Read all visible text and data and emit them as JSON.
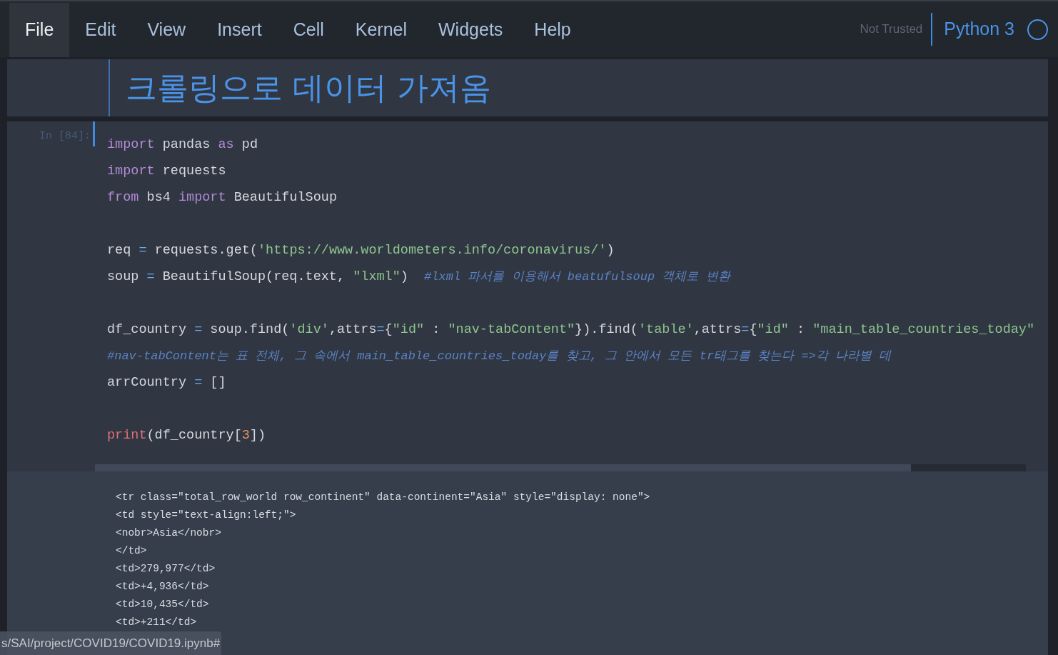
{
  "menu": [
    {
      "label": "File",
      "selected": true
    },
    {
      "label": "Edit",
      "selected": false
    },
    {
      "label": "View",
      "selected": false
    },
    {
      "label": "Insert",
      "selected": false
    },
    {
      "label": "Cell",
      "selected": false
    },
    {
      "label": "Kernel",
      "selected": false
    },
    {
      "label": "Widgets",
      "selected": false
    },
    {
      "label": "Help",
      "selected": false
    }
  ],
  "trust": "Not Trusted",
  "kernel": "Python 3",
  "markdown_cell": {
    "heading": "크롤링으로 데이터 가져옴"
  },
  "code_cell": {
    "prompt": "In [84]:",
    "blocks": [
      {
        "lines": [
          {
            "tokens": [
              {
                "text": "import",
                "kind": "keyword"
              },
              {
                "text": " pandas ",
                "kind": "plain"
              },
              {
                "text": "as",
                "kind": "keyword"
              },
              {
                "text": " pd",
                "kind": "plain"
              }
            ]
          },
          {
            "tokens": [
              {
                "text": "import",
                "kind": "keyword"
              },
              {
                "text": " requests",
                "kind": "plain"
              }
            ]
          },
          {
            "tokens": [
              {
                "text": "from",
                "kind": "keyword"
              },
              {
                "text": " bs4 ",
                "kind": "plain"
              },
              {
                "text": "import",
                "kind": "keyword"
              },
              {
                "text": " BeautifulSoup",
                "kind": "plain"
              }
            ]
          }
        ]
      },
      {
        "lines": [
          {
            "tokens": [
              {
                "text": "req ",
                "kind": "plain"
              },
              {
                "text": "=",
                "kind": "operator"
              },
              {
                "text": " requests.get(",
                "kind": "plain"
              },
              {
                "text": "'https://www.worldometers.info/coronavirus/'",
                "kind": "string"
              },
              {
                "text": ")",
                "kind": "plain"
              }
            ]
          },
          {
            "tokens": [
              {
                "text": "soup ",
                "kind": "plain"
              },
              {
                "text": "=",
                "kind": "operator"
              },
              {
                "text": " BeautifulSoup(req.text, ",
                "kind": "plain"
              },
              {
                "text": "\"lxml\"",
                "kind": "string"
              },
              {
                "text": ")  ",
                "kind": "plain"
              },
              {
                "text": "#lxml 파서를 이용해서 beatufulsoup 객체로 변환",
                "kind": "comment"
              }
            ]
          }
        ]
      },
      {
        "lines": [
          {
            "tokens": [
              {
                "text": "df_country ",
                "kind": "plain"
              },
              {
                "text": "=",
                "kind": "operator"
              },
              {
                "text": " soup.find(",
                "kind": "plain"
              },
              {
                "text": "'div'",
                "kind": "string"
              },
              {
                "text": ",attrs",
                "kind": "plain"
              },
              {
                "text": "=",
                "kind": "operator"
              },
              {
                "text": "{",
                "kind": "plain"
              },
              {
                "text": "\"id\"",
                "kind": "string"
              },
              {
                "text": " : ",
                "kind": "plain"
              },
              {
                "text": "\"nav-tabContent\"",
                "kind": "string"
              },
              {
                "text": "}).find(",
                "kind": "plain"
              },
              {
                "text": "'table'",
                "kind": "string"
              },
              {
                "text": ",attrs",
                "kind": "plain"
              },
              {
                "text": "=",
                "kind": "operator"
              },
              {
                "text": "{",
                "kind": "plain"
              },
              {
                "text": "\"id\"",
                "kind": "string"
              },
              {
                "text": " : ",
                "kind": "plain"
              },
              {
                "text": "\"main_table_countries_today\"",
                "kind": "string"
              }
            ]
          },
          {
            "tokens": [
              {
                "text": "#nav-tabContent는 표 전체, 그 속에서 main_table_countries_today를 찾고, 그 안에서 모든 tr태그를 찾는다 =>각 나라별 데",
                "kind": "comment"
              }
            ]
          },
          {
            "tokens": [
              {
                "text": "arrCountry ",
                "kind": "plain"
              },
              {
                "text": "=",
                "kind": "operator"
              },
              {
                "text": " []",
                "kind": "plain"
              }
            ]
          }
        ]
      },
      {
        "lines": [
          {
            "tokens": [
              {
                "text": "print",
                "kind": "builtin"
              },
              {
                "text": "(df_country[",
                "kind": "plain"
              },
              {
                "text": "3",
                "kind": "number"
              },
              {
                "text": "])",
                "kind": "plain"
              }
            ]
          }
        ]
      }
    ]
  },
  "output": [
    "<tr class=\"total_row_world row_continent\" data-continent=\"Asia\" style=\"display: none\">",
    "<td style=\"text-align:left;\">",
    "<nobr>Asia</nobr>",
    "</td>",
    "<td>279,977</td>",
    "<td>+4,936</td>",
    "<td>10,435</td>",
    "<td>+211</td>"
  ],
  "status_url": "s/SAI/project/COVID19/COVID19.ipynb#"
}
